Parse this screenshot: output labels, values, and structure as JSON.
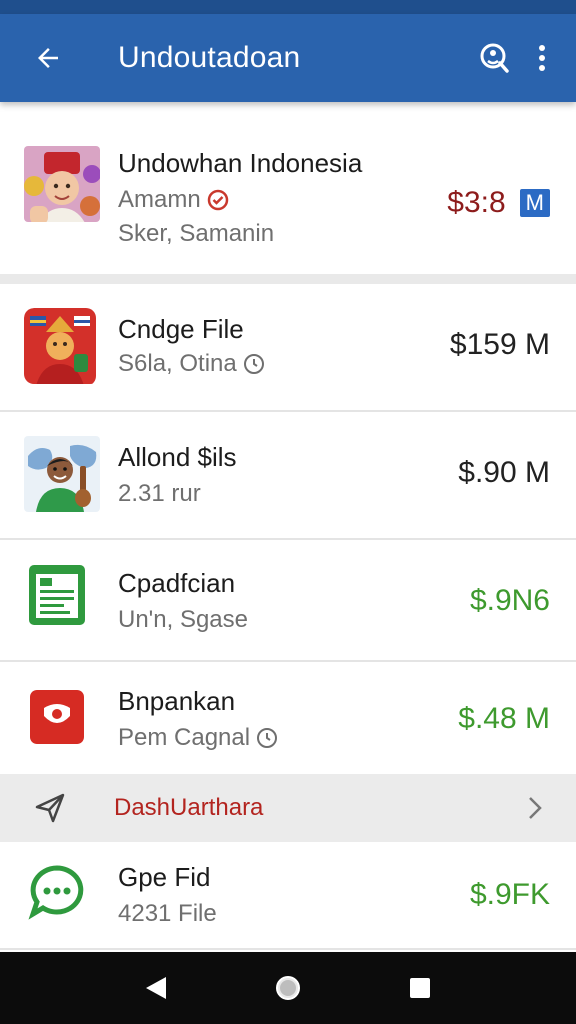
{
  "app_bar": {
    "title": "Undoutadoan",
    "back_icon": "arrow-back-icon",
    "search_icon": "search-chat-icon",
    "more_icon": "more-vert-icon"
  },
  "items": [
    {
      "name": "Undowhan Indonesia",
      "sub1": "Amamn",
      "sub2": "Sker, Samanin",
      "price": "$3:8",
      "badge": "M",
      "price_color": "#8d1c1c"
    },
    {
      "name": "Cndge File",
      "sub": "S6la, Otina",
      "price": "$159 M",
      "price_color": "#1c1c1c"
    },
    {
      "name": "Allond $ils",
      "sub": "2.31 rur",
      "price": "$.90 M",
      "price_color": "#1c1c1c"
    },
    {
      "name": "Cpadfcian",
      "sub": "Un'n, Sgase",
      "price": "$.9N6",
      "price_color": "#3e9a2e"
    },
    {
      "name": "Bnpankan",
      "sub": "Pem Cagnal",
      "price": "$.48 M",
      "price_color": "#3e9a2e"
    },
    {
      "name": "Gpe Fid",
      "sub": "4231 File",
      "price": "$.9FK",
      "price_color": "#3e9a2e"
    }
  ],
  "banner": {
    "label": "DashUarthara",
    "icon": "send-icon"
  },
  "nav": {
    "back": "nav-back-icon",
    "home": "nav-home-icon",
    "recents": "nav-recents-icon"
  },
  "colors": {
    "app_bar": "#2a63ad",
    "status_bar": "#1f4f8d",
    "green": "#3e9a2e",
    "red": "#b3241f"
  }
}
